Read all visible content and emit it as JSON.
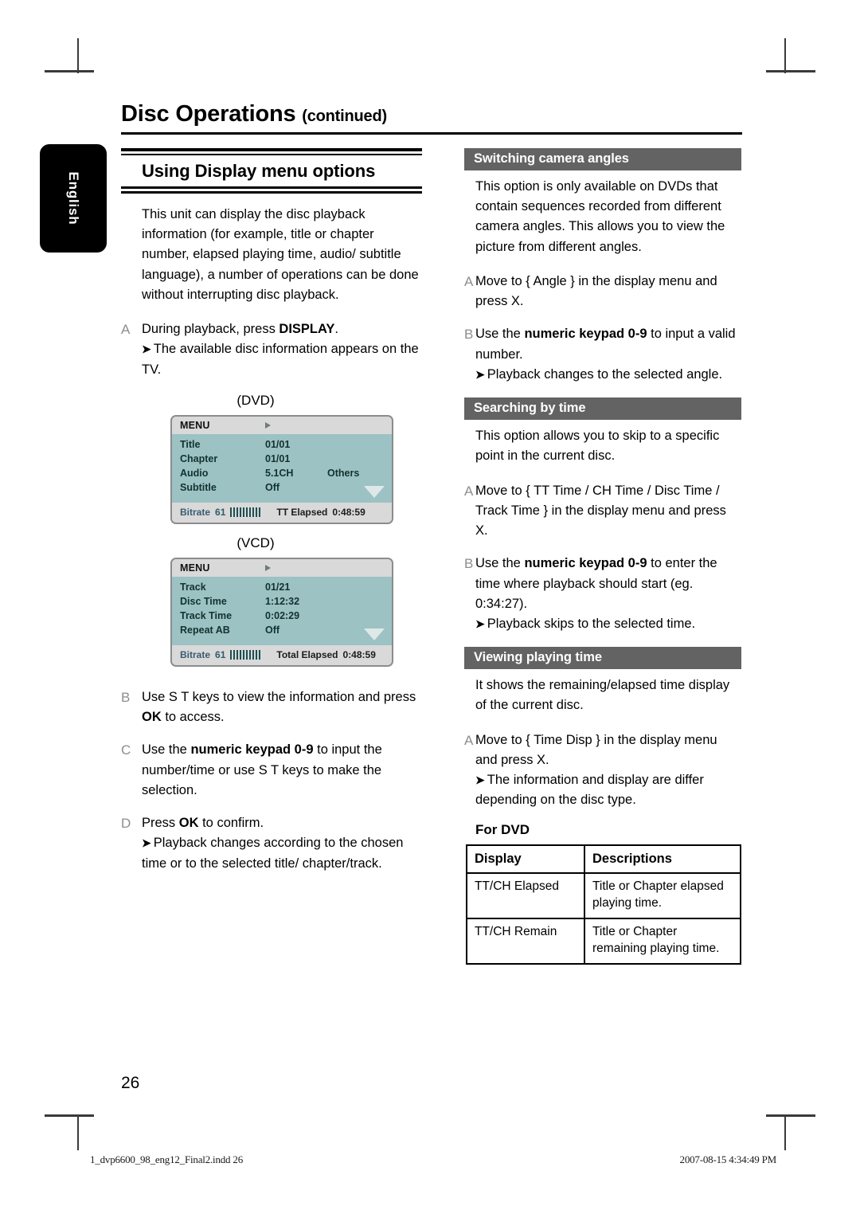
{
  "document": {
    "title": "Disc Operations",
    "title_suffix": "(continued)",
    "language_tab": "English",
    "page_number": "26"
  },
  "left_column": {
    "section_title": "Using Display menu options",
    "intro": "This unit can display the disc playback information (for example, title or chapter number, elapsed playing time, audio/ subtitle language), a number of operations can be done without interrupting disc playback.",
    "steps": [
      {
        "marker": "A",
        "text_before_bold": "During playback, press ",
        "bold": "DISPLAY",
        "text_after_bold": ".",
        "arrow_note": "The available disc information appears on the TV."
      },
      {
        "marker": "B",
        "text_before_bold": "Use  S T keys to view the information and press ",
        "bold": "OK",
        "text_after_bold": " to access.",
        "arrow_note": ""
      },
      {
        "marker": "C",
        "text_before_bold": "Use the ",
        "bold": "numeric keypad 0-9",
        "text_after_bold": " to input the number/time or use  S T keys to make the selection.",
        "arrow_note": ""
      },
      {
        "marker": "D",
        "text_before_bold": "Press ",
        "bold": "OK",
        "text_after_bold": " to confirm.",
        "arrow_note": "Playback changes according to the chosen time or to the selected title/ chapter/track."
      }
    ],
    "figures": [
      {
        "caption": "(DVD)",
        "menu_label": "MENU",
        "rows": [
          {
            "key": "Title",
            "value": "01/01",
            "extra": ""
          },
          {
            "key": "Chapter",
            "value": "01/01",
            "extra": ""
          },
          {
            "key": "Audio",
            "value": "5.1CH",
            "extra": "Others"
          },
          {
            "key": "Subtitle",
            "value": "Off",
            "extra": ""
          }
        ],
        "footer": {
          "bitrate_label": "Bitrate",
          "bitrate_value": "61",
          "time_label": "TT Elapsed",
          "time_value": "0:48:59"
        }
      },
      {
        "caption": "(VCD)",
        "menu_label": "MENU",
        "rows": [
          {
            "key": "Track",
            "value": "01/21",
            "extra": ""
          },
          {
            "key": "Disc  Time",
            "value": "1:12:32",
            "extra": ""
          },
          {
            "key": "Track  Time",
            "value": "0:02:29",
            "extra": ""
          },
          {
            "key": "Repeat  AB",
            "value": "Off",
            "extra": ""
          }
        ],
        "footer": {
          "bitrate_label": "Bitrate",
          "bitrate_value": "61",
          "time_label": "Total Elapsed",
          "time_value": "0:48:59"
        }
      }
    ]
  },
  "right_column": {
    "sections": [
      {
        "heading": "Switching camera angles",
        "intro": "This option is only available on DVDs that contain sequences recorded from different camera angles. This allows you to view the picture from different angles.",
        "steps": [
          {
            "marker": "A",
            "text_before_bold": "Move to { Angle } in the display menu and press  X.",
            "bold": "",
            "text_after_bold": "",
            "arrow_note": ""
          },
          {
            "marker": "B",
            "text_before_bold": "Use the ",
            "bold": "numeric keypad 0-9",
            "text_after_bold": " to input a valid number.",
            "arrow_note": "Playback changes to the selected angle."
          }
        ]
      },
      {
        "heading": "Searching by time",
        "intro": "This option allows you to skip to a specific point in the current disc.",
        "steps": [
          {
            "marker": "A",
            "text_before_bold": "Move to { TT Time / CH Time / Disc Time / Track Time } in the display menu and press  X.",
            "bold": "",
            "text_after_bold": "",
            "arrow_note": ""
          },
          {
            "marker": "B",
            "text_before_bold": "Use the ",
            "bold": "numeric keypad 0-9",
            "text_after_bold": " to enter the time where playback should start (eg. 0:34:27).",
            "arrow_note": "Playback skips to the selected time."
          }
        ]
      },
      {
        "heading": "Viewing playing time",
        "intro": "It shows the remaining/elapsed time display of the current disc.",
        "steps": [
          {
            "marker": "A",
            "text_before_bold": "Move to { Time Disp } in the display menu and press  X.",
            "bold": "",
            "text_after_bold": "",
            "arrow_note": "The information and display are differ depending on the disc type."
          }
        ]
      }
    ],
    "table": {
      "subhead": "For DVD",
      "headers": [
        "Display",
        "Descriptions"
      ],
      "rows": [
        [
          "TT/CH Elapsed",
          "Title or Chapter elapsed playing time."
        ],
        [
          "TT/CH Remain",
          "Title or Chapter remaining playing time."
        ]
      ]
    }
  },
  "footer": {
    "filename": "1_dvp6600_98_eng12_Final2.indd   26",
    "timestamp": "2007-08-15   4:34:49 PM"
  }
}
